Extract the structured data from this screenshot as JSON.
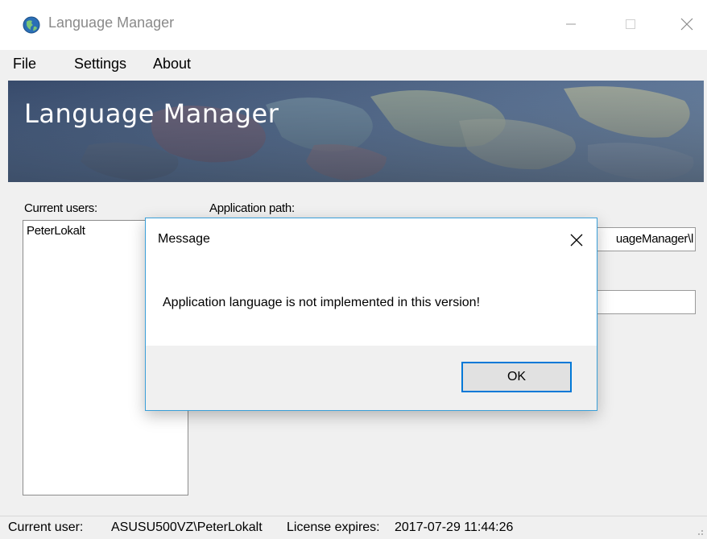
{
  "window": {
    "title": "Language Manager",
    "icon": "globe-icon",
    "controls": {
      "minimize": "minimize-icon",
      "maximize": "maximize-icon",
      "close": "close-icon"
    }
  },
  "menu": {
    "items": [
      {
        "label": "File"
      },
      {
        "label": "Settings"
      },
      {
        "label": "About"
      }
    ]
  },
  "banner": {
    "title": "Language Manager"
  },
  "main": {
    "users_label": "Current users:",
    "users": [
      "PeterLokalt"
    ],
    "path_label": "Application path:",
    "path_value_visible": "uageManager\\l"
  },
  "dialog": {
    "title": "Message",
    "message": "Application language is not implemented in this version!",
    "ok_label": "OK"
  },
  "statusbar": {
    "user_label": "Current user:",
    "user_value": "ASUSU500VZ\\PeterLokalt",
    "license_label": "License expires:",
    "license_value": "2017-07-29 11:44:26"
  },
  "colors": {
    "accent": "#0078d7",
    "dialog_border": "#3a9fd8",
    "chrome": "#f0f0f0"
  }
}
